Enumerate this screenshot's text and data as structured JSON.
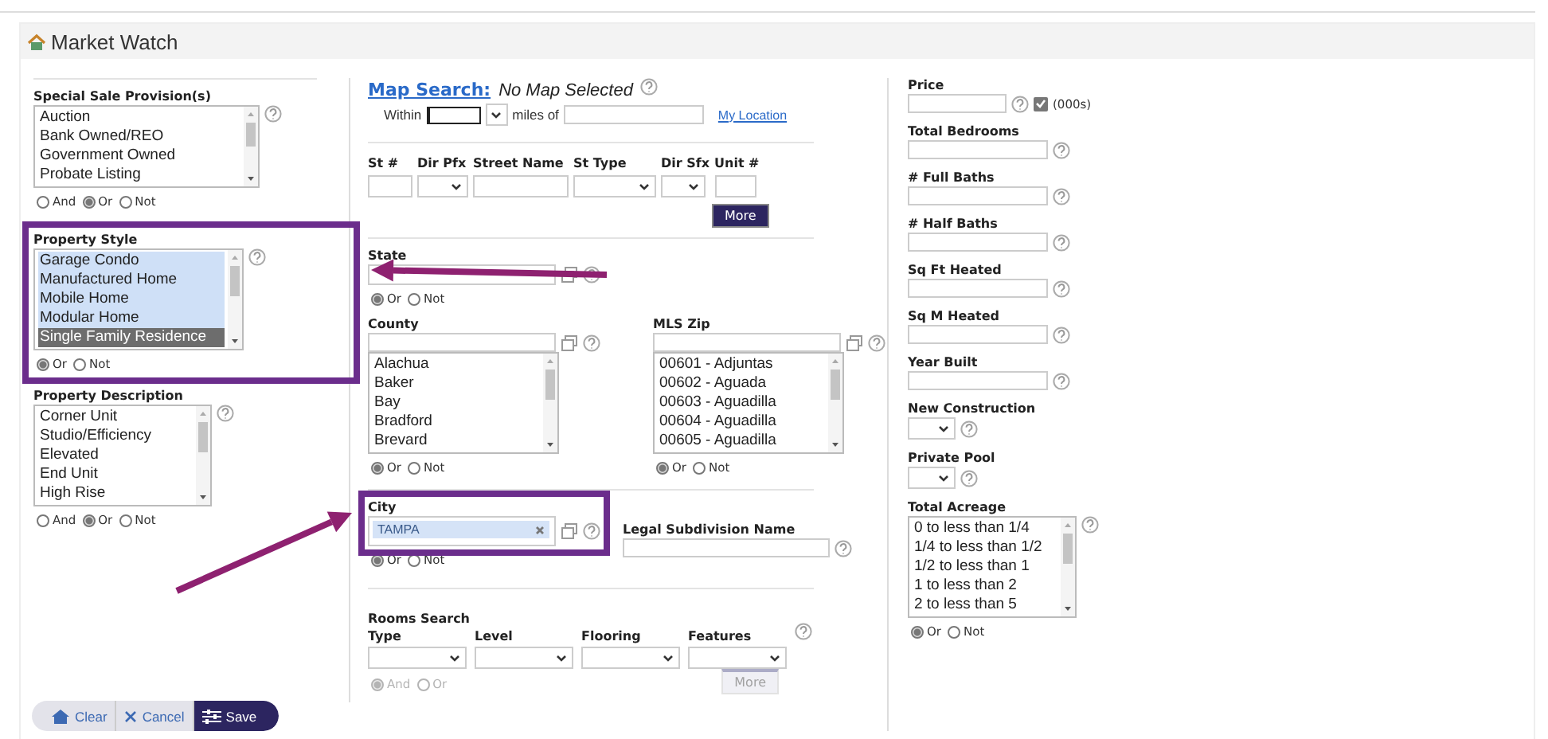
{
  "panel": {
    "title": "Market Watch"
  },
  "special_sale": {
    "label": "Special Sale Provision(s)",
    "options": [
      {
        "text": "Auction",
        "selected": false
      },
      {
        "text": "Bank Owned/REO",
        "selected": false
      },
      {
        "text": "Government Owned",
        "selected": false
      },
      {
        "text": "Probate Listing",
        "selected": false
      }
    ],
    "modes": [
      {
        "label": "And",
        "selected": false
      },
      {
        "label": "Or",
        "selected": true
      },
      {
        "label": "Not",
        "selected": false
      }
    ]
  },
  "property_style": {
    "label": "Property Style",
    "options": [
      {
        "text": "Garage Condo",
        "selected": true,
        "focused": false
      },
      {
        "text": "Manufactured Home",
        "selected": true,
        "focused": false
      },
      {
        "text": "Mobile Home",
        "selected": true,
        "focused": false
      },
      {
        "text": "Modular Home",
        "selected": true,
        "focused": false
      },
      {
        "text": "Single Family Residence",
        "selected": true,
        "focused": true
      }
    ],
    "modes": [
      {
        "label": "Or",
        "selected": true
      },
      {
        "label": "Not",
        "selected": false
      }
    ]
  },
  "property_description": {
    "label": "Property Description",
    "options": [
      {
        "text": "Corner Unit",
        "selected": false
      },
      {
        "text": "Studio/Efficiency",
        "selected": false
      },
      {
        "text": "Elevated",
        "selected": false
      },
      {
        "text": "End Unit",
        "selected": false
      },
      {
        "text": "High Rise",
        "selected": false
      }
    ],
    "modes": [
      {
        "label": "And",
        "selected": false
      },
      {
        "label": "Or",
        "selected": true
      },
      {
        "label": "Not",
        "selected": false
      }
    ]
  },
  "map_search": {
    "link": "Map Search:",
    "status": "No Map Selected",
    "within_label": "Within",
    "miles_label": "miles of",
    "location_link": "My Location"
  },
  "address": {
    "fields": [
      {
        "label": "St #",
        "kind": "text"
      },
      {
        "label": "Dir Pfx",
        "kind": "select"
      },
      {
        "label": "Street Name",
        "kind": "text"
      },
      {
        "label": "St Type",
        "kind": "select"
      },
      {
        "label": "Dir Sfx",
        "kind": "select"
      },
      {
        "label": "Unit #",
        "kind": "text"
      }
    ],
    "more_button": "More"
  },
  "state": {
    "label": "State",
    "modes": [
      {
        "label": "Or",
        "selected": true
      },
      {
        "label": "Not",
        "selected": false
      }
    ]
  },
  "county": {
    "label": "County",
    "options": [
      {
        "text": "Alachua",
        "selected": false
      },
      {
        "text": "Baker",
        "selected": false
      },
      {
        "text": "Bay",
        "selected": false
      },
      {
        "text": "Bradford",
        "selected": false
      },
      {
        "text": "Brevard",
        "selected": false
      }
    ],
    "modes": [
      {
        "label": "Or",
        "selected": true
      },
      {
        "label": "Not",
        "selected": false
      }
    ]
  },
  "mls_zip": {
    "label": "MLS Zip",
    "options": [
      {
        "text": "00601 - Adjuntas",
        "selected": false
      },
      {
        "text": "00602 - Aguada",
        "selected": false
      },
      {
        "text": "00603 - Aguadilla",
        "selected": false
      },
      {
        "text": "00604 - Aguadilla",
        "selected": false
      },
      {
        "text": "00605 - Aguadilla",
        "selected": false
      }
    ],
    "modes": [
      {
        "label": "Or",
        "selected": true
      },
      {
        "label": "Not",
        "selected": false
      }
    ]
  },
  "city": {
    "label": "City",
    "tokens": [
      "TAMPA"
    ],
    "modes": [
      {
        "label": "Or",
        "selected": true
      },
      {
        "label": "Not",
        "selected": false
      }
    ]
  },
  "legal_subdivision": {
    "label": "Legal Subdivision Name"
  },
  "rooms_search": {
    "title": "Rooms Search",
    "columns": [
      "Type",
      "Level",
      "Flooring",
      "Features"
    ],
    "disabled": true,
    "modes": [
      {
        "label": "And",
        "selected": true
      },
      {
        "label": "Or",
        "selected": false
      }
    ],
    "more_button": "More"
  },
  "price": {
    "label": "Price",
    "unit_checkbox": {
      "label": "(000s)",
      "checked": true
    }
  },
  "right_fields": [
    {
      "label": "Total Bedrooms",
      "kind": "text"
    },
    {
      "label": "# Full Baths",
      "kind": "text"
    },
    {
      "label": "# Half Baths",
      "kind": "text"
    },
    {
      "label": "Sq Ft Heated",
      "kind": "text"
    },
    {
      "label": "Sq M Heated",
      "kind": "text"
    },
    {
      "label": "Year Built",
      "kind": "text"
    },
    {
      "label": "New Construction",
      "kind": "select"
    },
    {
      "label": "Private Pool",
      "kind": "select"
    }
  ],
  "total_acreage": {
    "label": "Total Acreage",
    "options": [
      {
        "text": "0 to less than 1/4",
        "selected": false
      },
      {
        "text": "1/4 to less than 1/2",
        "selected": false
      },
      {
        "text": "1/2 to less than 1",
        "selected": false
      },
      {
        "text": "1 to less than 2",
        "selected": false
      },
      {
        "text": "2 to less than 5",
        "selected": false
      }
    ],
    "modes": [
      {
        "label": "Or",
        "selected": true
      },
      {
        "label": "Not",
        "selected": false
      }
    ]
  },
  "actions": [
    {
      "label": "Clear",
      "kind": "clear"
    },
    {
      "label": "Cancel",
      "kind": "cancel"
    },
    {
      "label": "Save",
      "kind": "save"
    }
  ]
}
